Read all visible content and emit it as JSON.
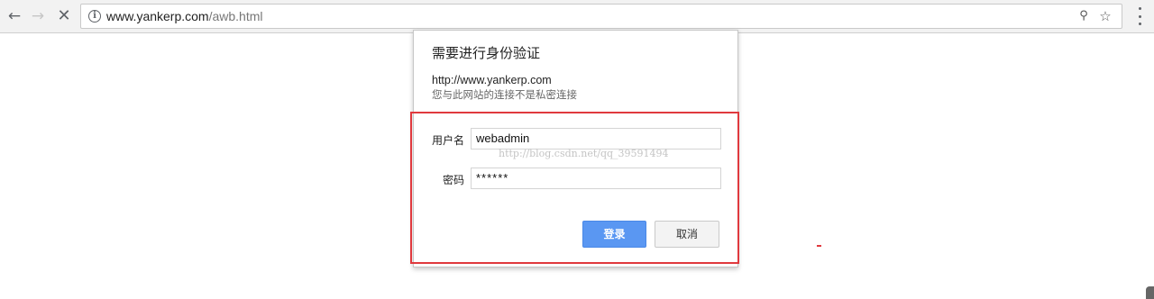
{
  "browser": {
    "url_host": "www.yankerp.com",
    "url_path": "/awb.html",
    "icons": {
      "back": "arrow-left-icon",
      "forward": "arrow-right-icon",
      "stop": "stop-loading-icon",
      "info": "info-icon",
      "key": "key-icon",
      "star": "star-icon",
      "menu": "kebab-menu-icon"
    }
  },
  "auth_dialog": {
    "title": "需要进行身份验证",
    "origin": "http://www.yankerp.com",
    "description": "您与此网站的连接不是私密连接",
    "username_label": "用户名",
    "username_value": "webadmin",
    "password_label": "密码",
    "password_value": "******",
    "login_button": "登录",
    "cancel_button": "取消"
  },
  "watermark": "http://blog.csdn.net/qq_39591494",
  "colors": {
    "highlight_border": "#e0393e",
    "primary_button": "#5a97f2"
  }
}
